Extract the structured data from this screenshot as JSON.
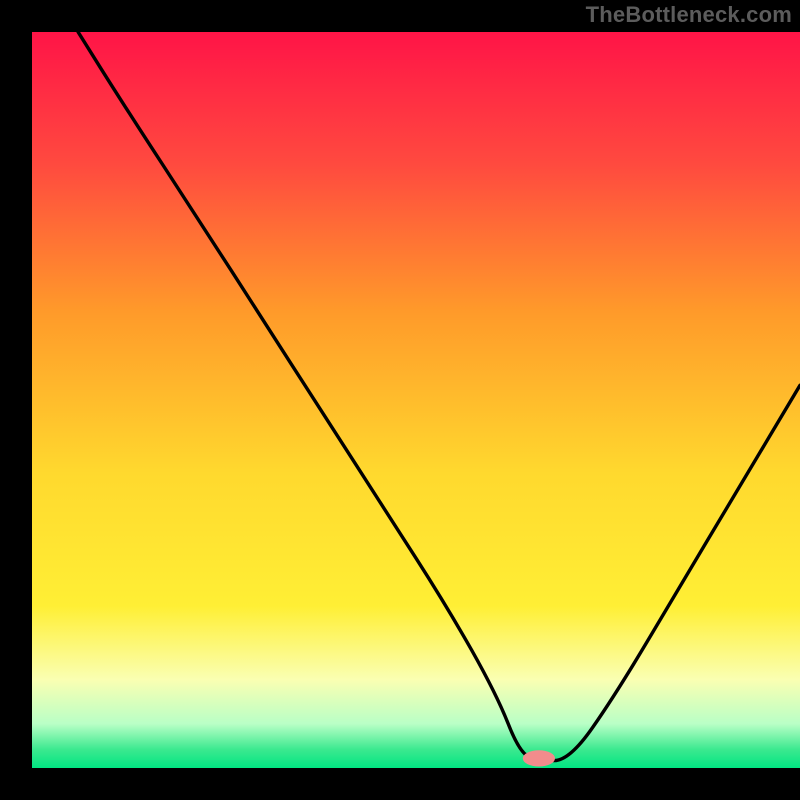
{
  "watermark": "TheBottleneck.com",
  "chart_data": {
    "type": "line",
    "title": "",
    "xlabel": "",
    "ylabel": "",
    "x_range": [
      0,
      100
    ],
    "y_range": [
      0,
      100
    ],
    "background_gradient": {
      "top": "#ff1447",
      "upper_mid": "#ff9a2a",
      "mid": "#ffe930",
      "lower": "#faffb2",
      "band": "#6cf29c",
      "bottom": "#01e582"
    },
    "curve": {
      "name": "bottleneck-curve",
      "color": "#000000",
      "x": [
        6,
        12,
        22,
        30,
        38,
        46,
        54,
        60.5,
        63.5,
        66,
        70,
        76,
        84,
        92,
        100
      ],
      "y": [
        100,
        90,
        74,
        61,
        48,
        35,
        22,
        10,
        2,
        1,
        1,
        10,
        24,
        38,
        52
      ]
    },
    "marker": {
      "name": "optimal-point",
      "color": "#f28c8c",
      "x": 66,
      "y": 1.3,
      "rx": 2.1,
      "ry": 1.1
    }
  }
}
